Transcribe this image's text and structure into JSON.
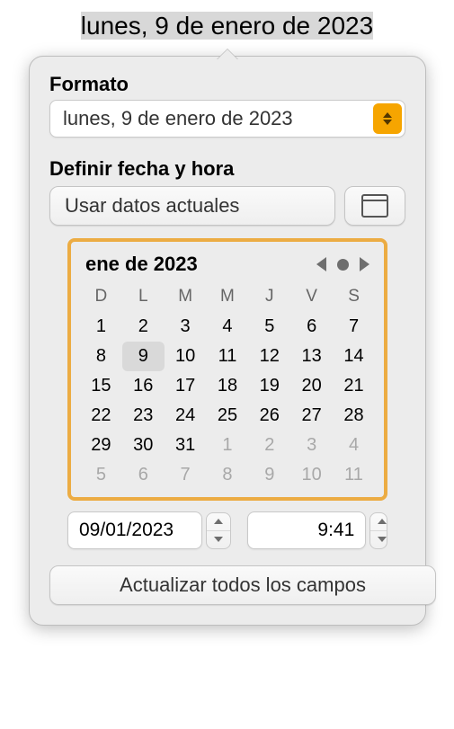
{
  "header_text": "lunes, 9 de enero de 2023",
  "format": {
    "label": "Formato",
    "selected": "lunes, 9 de enero de 2023"
  },
  "define": {
    "label": "Definir fecha y hora",
    "use_current": "Usar datos actuales"
  },
  "calendar": {
    "title": "ene de 2023",
    "weekdays": [
      "D",
      "L",
      "M",
      "M",
      "J",
      "V",
      "S"
    ],
    "rows": [
      [
        {
          "n": 1
        },
        {
          "n": 2
        },
        {
          "n": 3
        },
        {
          "n": 4
        },
        {
          "n": 5
        },
        {
          "n": 6
        },
        {
          "n": 7
        }
      ],
      [
        {
          "n": 8
        },
        {
          "n": 9,
          "sel": true
        },
        {
          "n": 10
        },
        {
          "n": 11
        },
        {
          "n": 12
        },
        {
          "n": 13
        },
        {
          "n": 14
        }
      ],
      [
        {
          "n": 15
        },
        {
          "n": 16
        },
        {
          "n": 17
        },
        {
          "n": 18
        },
        {
          "n": 19
        },
        {
          "n": 20
        },
        {
          "n": 21
        }
      ],
      [
        {
          "n": 22
        },
        {
          "n": 23
        },
        {
          "n": 24
        },
        {
          "n": 25
        },
        {
          "n": 26
        },
        {
          "n": 27
        },
        {
          "n": 28
        }
      ],
      [
        {
          "n": 29
        },
        {
          "n": 30
        },
        {
          "n": 31
        },
        {
          "n": 1,
          "dim": true
        },
        {
          "n": 2,
          "dim": true
        },
        {
          "n": 3,
          "dim": true
        },
        {
          "n": 4,
          "dim": true
        }
      ],
      [
        {
          "n": 5,
          "dim": true
        },
        {
          "n": 6,
          "dim": true
        },
        {
          "n": 7,
          "dim": true
        },
        {
          "n": 8,
          "dim": true
        },
        {
          "n": 9,
          "dim": true
        },
        {
          "n": 10,
          "dim": true
        },
        {
          "n": 11,
          "dim": true
        }
      ]
    ]
  },
  "date_input": "09/01/2023",
  "time_input": "9:41",
  "update_all": "Actualizar todos los campos"
}
